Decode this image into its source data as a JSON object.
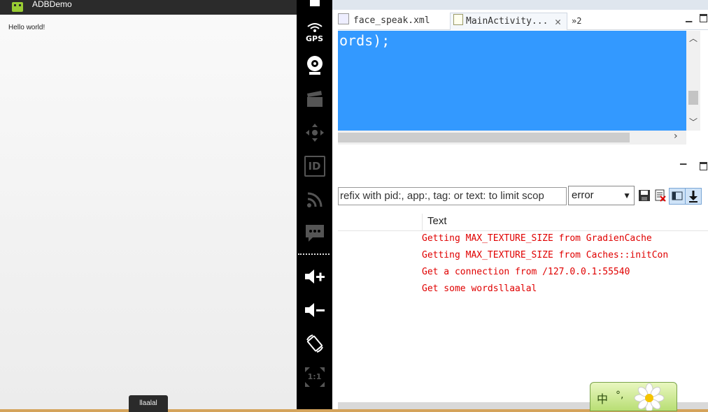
{
  "emulator": {
    "app_title": "ADBDemo",
    "content_text": "Hello world!",
    "toast_text": "llaalal"
  },
  "controls": {
    "gps_label": "GPS",
    "id_label": "ID",
    "one_to_one_label": "1:1"
  },
  "editor": {
    "tabs": [
      {
        "label": "face_speak.xml"
      },
      {
        "label": "MainActivity..."
      }
    ],
    "tab_overflow": "»2",
    "code_visible": "ords);"
  },
  "logcat": {
    "filter_placeholder": "refix with pid:, app:, tag: or text: to limit scop",
    "level_selected": "error",
    "columns": [
      "Text"
    ],
    "rows": [
      {
        "text": "Getting MAX_TEXTURE_SIZE from GradienCache"
      },
      {
        "text": "Getting MAX_TEXTURE_SIZE from Caches::initCon"
      },
      {
        "text": "Get a connection from /127.0.0.1:55540"
      },
      {
        "text": "Get some wordsllaalal"
      }
    ]
  },
  "ime": {
    "char": "中",
    "punct": "°,"
  },
  "colors": {
    "log_error": "#e00000",
    "selection": "#3399ff"
  }
}
